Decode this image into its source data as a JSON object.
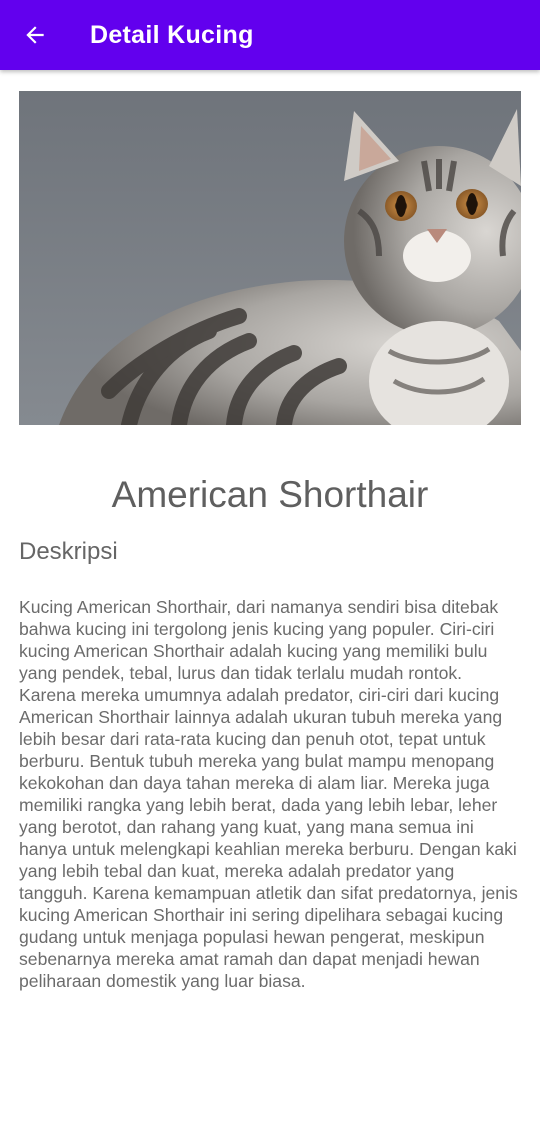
{
  "app_bar": {
    "title": "Detail Kucing",
    "back_icon": "arrow-back-icon",
    "background": "#6200ee"
  },
  "cat": {
    "name": "American Shorthair",
    "section_label": "Deskripsi",
    "description": "Kucing American Shorthair, dari namanya sendiri bisa ditebak bahwa kucing ini tergolong jenis kucing yang populer. Ciri-ciri kucing American Shorthair adalah kucing yang memiliki bulu yang pendek, tebal, lurus dan tidak terlalu mudah rontok. Karena mereka umumnya adalah predator, ciri-ciri dari kucing American Shorthair lainnya adalah ukuran tubuh mereka yang lebih besar dari rata-rata kucing dan penuh otot, tepat untuk berburu. Bentuk tubuh mereka yang bulat mampu menopang kekokohan dan daya tahan mereka di alam liar. Mereka juga memiliki rangka yang lebih berat, dada yang lebih lebar, leher yang berotot, dan rahang yang kuat, yang mana semua ini hanya untuk melengkapi keahlian mereka berburu. Dengan kaki yang lebih tebal dan kuat, mereka adalah predator yang tangguh. Karena kemampuan atletik dan sifat predatornya, jenis kucing American Shorthair ini sering dipelihara sebagai kucing gudang untuk menjaga populasi hewan pengerat, meskipun sebenarnya mereka amat ramah dan dapat menjadi hewan peliharaan domestik yang luar biasa."
  }
}
